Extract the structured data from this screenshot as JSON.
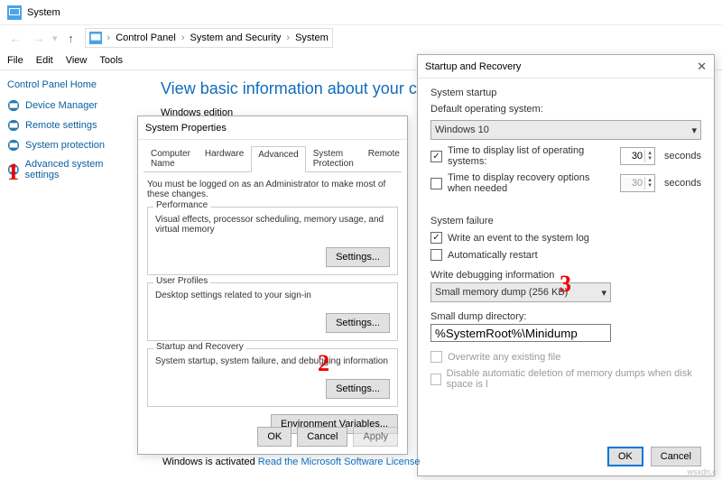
{
  "window": {
    "title": "System"
  },
  "nav": {
    "back": "←",
    "fwd": "→",
    "up": "↑"
  },
  "breadcrumb": [
    "Control Panel",
    "System and Security",
    "System"
  ],
  "menubar": [
    "File",
    "Edit",
    "View",
    "Tools"
  ],
  "sidebar": {
    "title": "Control Panel Home",
    "items": [
      "Device Manager",
      "Remote settings",
      "System protection",
      "Advanced system settings"
    ]
  },
  "page": {
    "title": "View basic information about your computer",
    "edition_heading": "Windows edition"
  },
  "sysprops": {
    "title": "System Properties",
    "tabs": [
      "Computer Name",
      "Hardware",
      "Advanced",
      "System Protection",
      "Remote"
    ],
    "active_tab": "Advanced",
    "intro": "You must be logged on as an Administrator to make most of these changes.",
    "groups": {
      "perf": {
        "label": "Performance",
        "desc": "Visual effects, processor scheduling, memory usage, and virtual memory",
        "btn": "Settings..."
      },
      "profiles": {
        "label": "User Profiles",
        "desc": "Desktop settings related to your sign-in",
        "btn": "Settings..."
      },
      "startup": {
        "label": "Startup and Recovery",
        "desc": "System startup, system failure, and debugging information",
        "btn": "Settings..."
      }
    },
    "env_btn": "Environment Variables...",
    "ok": "OK",
    "cancel": "Cancel",
    "apply": "Apply"
  },
  "startrec": {
    "title": "Startup and Recovery",
    "sys_startup_h": "System startup",
    "default_os_label": "Default operating system:",
    "default_os": "Windows 10",
    "time_list": {
      "checked": true,
      "label": "Time to display list of operating systems:",
      "value": "30",
      "unit": "seconds"
    },
    "time_recov": {
      "checked": false,
      "label": "Time to display recovery options when needed",
      "value": "30",
      "unit": "seconds"
    },
    "sys_failure_h": "System failure",
    "write_event": {
      "checked": true,
      "label": "Write an event to the system log"
    },
    "auto_restart": {
      "checked": false,
      "label": "Automatically restart"
    },
    "wdi_label": "Write debugging information",
    "wdi_value": "Small memory dump (256 KB)",
    "dump_label": "Small dump directory:",
    "dump_value": "%SystemRoot%\\Minidump",
    "overwrite": {
      "label": "Overwrite any existing file"
    },
    "disable_auto_del": {
      "label": "Disable automatic deletion of memory dumps when disk space is l"
    },
    "ok": "OK",
    "cancel": "Cancel"
  },
  "activation": {
    "line": "Windows is activated ",
    "link": "Read the Microsoft Software License"
  },
  "annotations": {
    "1": "1",
    "2": "2",
    "3": "3"
  },
  "watermark": "wsxdn.c"
}
